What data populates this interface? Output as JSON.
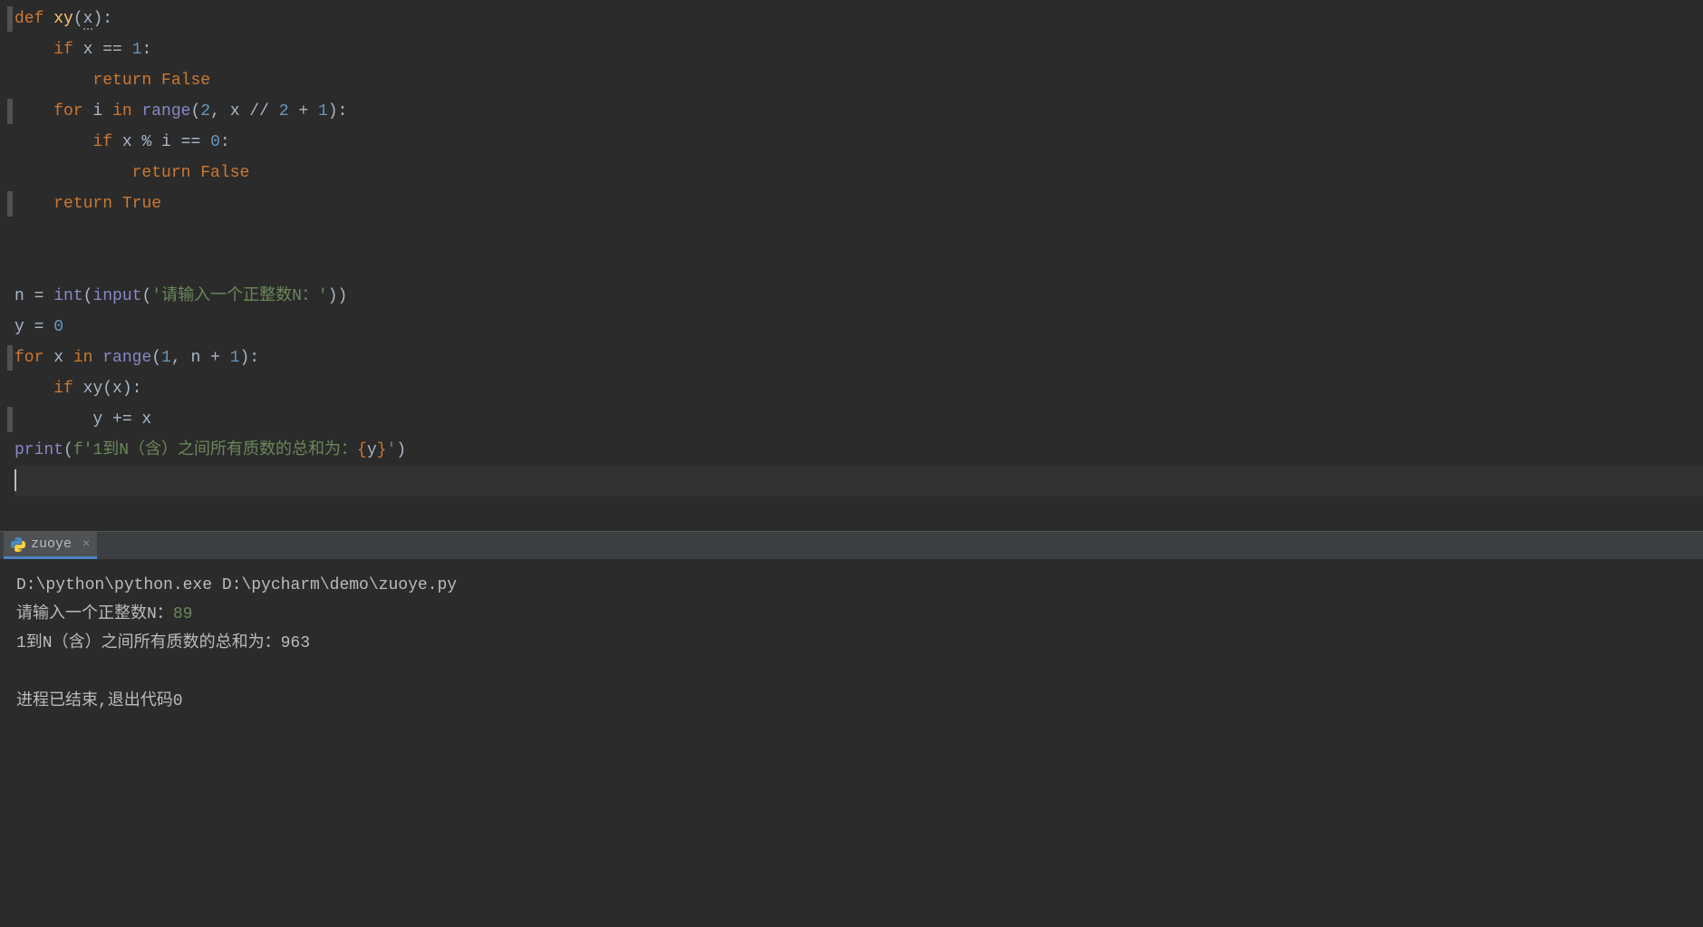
{
  "code": {
    "line1": {
      "def": "def",
      "name": "xy",
      "lp": "(",
      "p": "x",
      "rp": "):"
    },
    "line2": {
      "indent": "    ",
      "if": "if",
      "expr": " x ",
      "eq": "==",
      "sp": " ",
      "one": "1",
      "colon": ":"
    },
    "line3": {
      "indent": "        ",
      "ret": "return",
      "sp": " ",
      "val": "False"
    },
    "line4": {
      "indent": "    ",
      "for": "for",
      "i": " i ",
      "in": "in",
      "sp": " ",
      "range": "range",
      "lp": "(",
      "two": "2",
      "comma": ", x // ",
      "two2": "2",
      "plus": " + ",
      "one": "1",
      "rp": "):"
    },
    "line5": {
      "indent": "        ",
      "if": "if",
      "x": " x % i ",
      "eq": "==",
      "sp": " ",
      "zero": "0",
      "colon": ":"
    },
    "line6": {
      "indent": "            ",
      "ret": "return",
      "sp": " ",
      "val": "False"
    },
    "line7": {
      "indent": "    ",
      "ret": "return",
      "sp": " ",
      "val": "True"
    },
    "line8": "",
    "line9": "",
    "line10": {
      "n": "n = ",
      "int": "int",
      "lp": "(",
      "input": "input",
      "lp2": "(",
      "str": "'请输入一个正整数N：'",
      "rp": "))"
    },
    "line11": {
      "y": "y = ",
      "zero": "0"
    },
    "line12": {
      "for": "for",
      "x": " x ",
      "in": "in",
      "sp": " ",
      "range": "range",
      "lp": "(",
      "one": "1",
      "comma": ", n + ",
      "one2": "1",
      "rp": "):"
    },
    "line13": {
      "indent": "    ",
      "if": "if",
      "sp": " ",
      "xy": "xy",
      "lp": "(x):"
    },
    "line14": {
      "indent": "        ",
      "y": "y += x"
    },
    "line15": {
      "print": "print",
      "lp": "(",
      "f": "f'1到N（含）之间所有质数的总和为：",
      "lb": "{",
      "y": "y",
      "rb": "}",
      "end": "'",
      ")": ")"
    }
  },
  "tab": {
    "name": "zuoye"
  },
  "console": {
    "line1": "D:\\python\\python.exe D:\\pycharm\\demo\\zuoye.py",
    "line2_prompt": "请输入一个正整数N：",
    "line2_input": "89",
    "line3": "1到N（含）之间所有质数的总和为：963",
    "line4": "",
    "line5": "进程已结束,退出代码0"
  }
}
